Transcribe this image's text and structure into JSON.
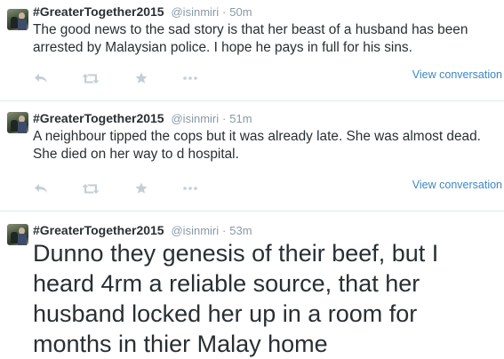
{
  "tweets": [
    {
      "name": "#GreaterTogether2015",
      "handle": "@isinmiri",
      "separator": "·",
      "time": "50m",
      "text": "The good news to the sad story is that her beast of a husband has been arrested by Malaysian police. I hope he pays in full for his sins.",
      "view_conversation": "View conversation"
    },
    {
      "name": "#GreaterTogether2015",
      "handle": "@isinmiri",
      "separator": "·",
      "time": "51m",
      "text": "A neighbour tipped the cops but it was already late. She was almost dead. She died on her way to d hospital.",
      "view_conversation": "View conversation"
    },
    {
      "name": "#GreaterTogether2015",
      "handle": "@isinmiri",
      "separator": "·",
      "time": "53m",
      "text": "Dunno they genesis of their beef, but I heard 4rm a reliable source, that her husband locked her up in a room for months in thier Malay home"
    }
  ],
  "icons": {
    "reply": "reply-icon",
    "retweet": "retweet-icon",
    "favorite": "star-icon",
    "more": "more-icon",
    "icon_color": "#c4ced6",
    "link_color": "#3b88c3"
  }
}
